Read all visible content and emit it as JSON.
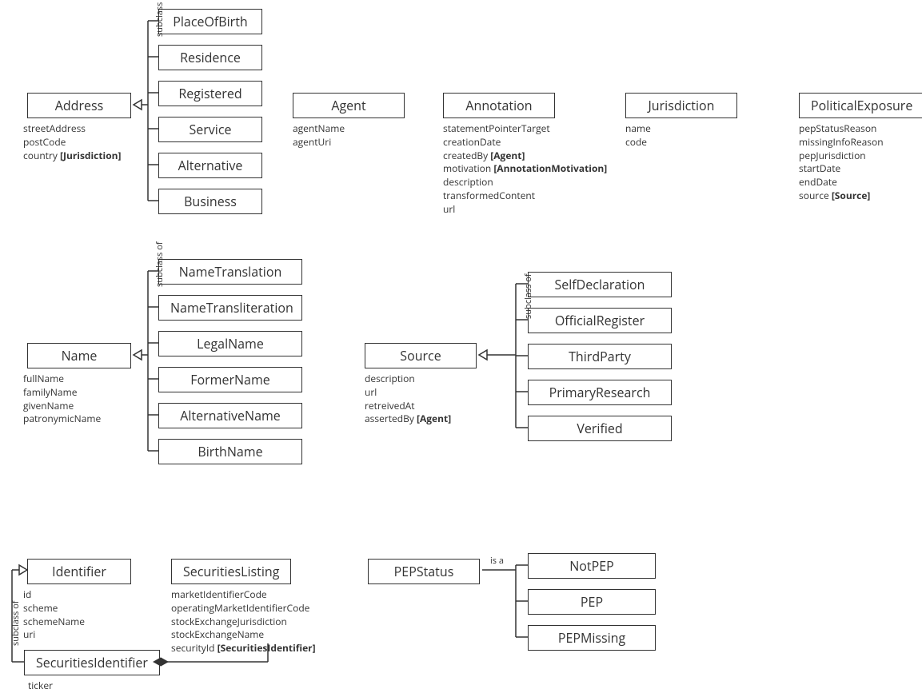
{
  "labels": {
    "subclass_of": "subclass of",
    "is_a": "is a"
  },
  "address": {
    "class": "Address",
    "attrs": {
      "a1": "streetAddress",
      "a2": "postCode",
      "a3_pre": "country ",
      "a3_ref": "[Jurisdiction]"
    },
    "subs": {
      "s1": "PlaceOfBirth",
      "s2": "Residence",
      "s3": "Registered",
      "s4": "Service",
      "s5": "Alternative",
      "s6": "Business"
    }
  },
  "agent": {
    "class": "Agent",
    "attrs": {
      "a1": "agentName",
      "a2": "agentUri"
    }
  },
  "annotation": {
    "class": "Annotation",
    "attrs": {
      "a1": "statementPointerTarget",
      "a2": "creationDate",
      "a3_pre": "createdBy ",
      "a3_ref": "[Agent]",
      "a4_pre": "motivation ",
      "a4_ref": "[AnnotationMotivation]",
      "a5": "description",
      "a6": "transformedContent",
      "a7": "url"
    }
  },
  "jurisdiction": {
    "class": "Jurisdiction",
    "attrs": {
      "a1": "name",
      "a2": "code"
    }
  },
  "political": {
    "class": "PoliticalExposure",
    "attrs": {
      "a1": "pepStatusReason",
      "a2": "missingInfoReason",
      "a3": "pepJurisdiction",
      "a4": "startDate",
      "a5": "endDate",
      "a6_pre": "source ",
      "a6_ref": "[Source]"
    }
  },
  "name": {
    "class": "Name",
    "attrs": {
      "a1": "fullName",
      "a2": "familyName",
      "a3": "givenName",
      "a4": "patronymicName"
    },
    "subs": {
      "s1": "NameTranslation",
      "s2": "NameTransliteration",
      "s3": "LegalName",
      "s4": "FormerName",
      "s5": "AlternativeName",
      "s6": "BirthName"
    }
  },
  "source": {
    "class": "Source",
    "attrs": {
      "a1": "description",
      "a2": "url",
      "a3": "retreivedAt",
      "a4_pre": "assertedBy ",
      "a4_ref": "[Agent]"
    },
    "subs": {
      "s1": "SelfDeclaration",
      "s2": "OfficialRegister",
      "s3": "ThirdParty",
      "s4": "PrimaryResearch",
      "s5": "Verified"
    }
  },
  "identifier": {
    "class": "Identifier",
    "attrs": {
      "a1": "id",
      "a2": "scheme",
      "a3": "schemeName",
      "a4": "uri"
    }
  },
  "securitiesListing": {
    "class": "SecuritiesListing",
    "attrs": {
      "a1": "marketIdentifierCode",
      "a2": "operatingMarketIdentifierCode",
      "a3": "stockExchangeJurisdiction",
      "a4": "stockExchangeName",
      "a5_pre": "securityId ",
      "a5_ref": "[SecuritiesIdentifier]"
    }
  },
  "securitiesIdentifier": {
    "class": "SecuritiesIdentifier",
    "attrs": {
      "a1": "ticker"
    }
  },
  "pepstatus": {
    "class": "PEPStatus",
    "subs": {
      "s1": "NotPEP",
      "s2": "PEP",
      "s3": "PEPMissing"
    }
  }
}
